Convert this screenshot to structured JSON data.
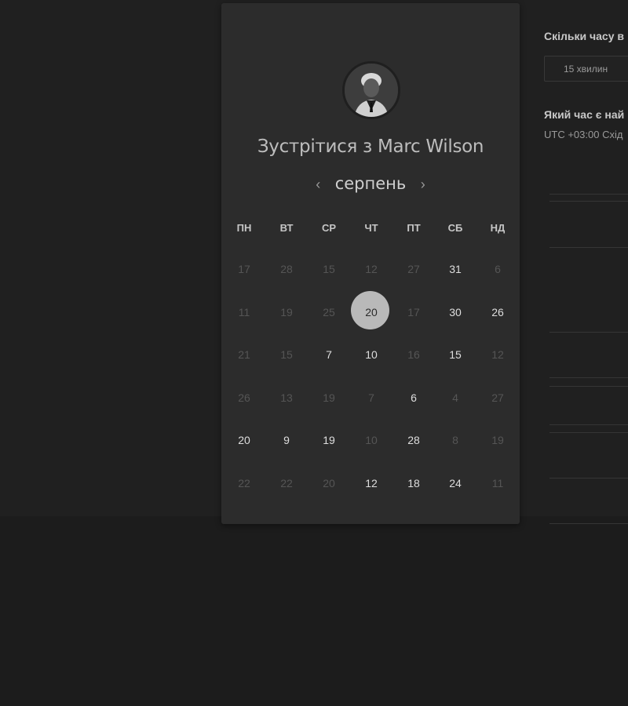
{
  "host": {
    "heading": "Зустрітися з Marc Wilson"
  },
  "calendar": {
    "month": "серпень",
    "prev_icon": "chevron-left-icon",
    "next_icon": "chevron-right-icon",
    "weekdays": [
      "ПН",
      "ВТ",
      "СР",
      "ЧТ",
      "ПТ",
      "СБ",
      "НД"
    ],
    "weeks": [
      [
        {
          "d": "17",
          "s": "f"
        },
        {
          "d": "28",
          "s": "f"
        },
        {
          "d": "15",
          "s": "f"
        },
        {
          "d": "12",
          "s": "f"
        },
        {
          "d": "27",
          "s": "f"
        },
        {
          "d": "31",
          "s": "a"
        },
        {
          "d": "6",
          "s": "f"
        }
      ],
      [
        {
          "d": "11",
          "s": "f"
        },
        {
          "d": "19",
          "s": "f"
        },
        {
          "d": "25",
          "s": "f"
        },
        {
          "d": "20",
          "s": "sel"
        },
        {
          "d": "17",
          "s": "f"
        },
        {
          "d": "30",
          "s": "a"
        },
        {
          "d": "26",
          "s": "a"
        }
      ],
      [
        {
          "d": "21",
          "s": "f"
        },
        {
          "d": "15",
          "s": "f"
        },
        {
          "d": "7",
          "s": "a"
        },
        {
          "d": "10",
          "s": "a"
        },
        {
          "d": "16",
          "s": "f"
        },
        {
          "d": "15",
          "s": "a"
        },
        {
          "d": "12",
          "s": "f"
        }
      ],
      [
        {
          "d": "26",
          "s": "f"
        },
        {
          "d": "13",
          "s": "f"
        },
        {
          "d": "19",
          "s": "f"
        },
        {
          "d": "7",
          "s": "f"
        },
        {
          "d": "6",
          "s": "a"
        },
        {
          "d": "4",
          "s": "f"
        },
        {
          "d": "27",
          "s": "f"
        }
      ],
      [
        {
          "d": "20",
          "s": "a"
        },
        {
          "d": "9",
          "s": "a"
        },
        {
          "d": "19",
          "s": "a"
        },
        {
          "d": "10",
          "s": "f"
        },
        {
          "d": "28",
          "s": "a"
        },
        {
          "d": "8",
          "s": "f"
        },
        {
          "d": "19",
          "s": "f"
        }
      ],
      [
        {
          "d": "22",
          "s": "f"
        },
        {
          "d": "22",
          "s": "f"
        },
        {
          "d": "20",
          "s": "f"
        },
        {
          "d": "12",
          "s": "a"
        },
        {
          "d": "18",
          "s": "a"
        },
        {
          "d": "24",
          "s": "a"
        },
        {
          "d": "11",
          "s": "f"
        }
      ]
    ]
  },
  "side": {
    "duration_question": "Скільки часу в",
    "duration_value": "15 хвилин",
    "time_question": "Який час є най",
    "timezone": "UTC +03:00 Схід"
  }
}
